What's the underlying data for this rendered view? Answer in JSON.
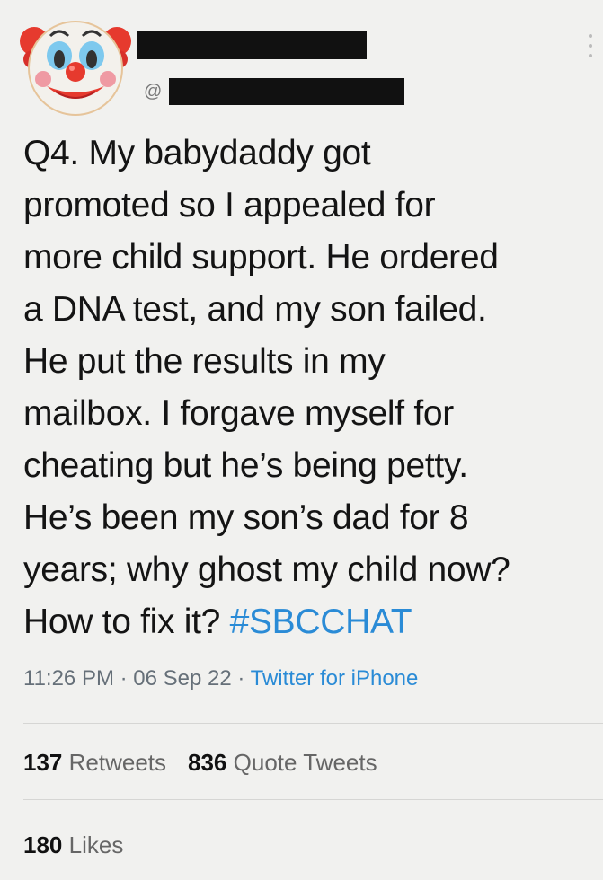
{
  "tweet": {
    "handle_prefix": "@",
    "text": "Q4. My babydaddy got\npromoted so I appealed for\nmore child support. He ordered\na DNA test, and my son failed.\nHe put the results in my\nmailbox. I forgave myself for\ncheating but he’s being petty.\nHe’s been my son’s dad for 8\nyears; why ghost my child now?\nHow to fix it? ",
    "hashtag": "#SBCCHAT",
    "time": "11:26 PM",
    "date": "06 Sep 22",
    "separator": " · ",
    "source": "Twitter for iPhone"
  },
  "stats": {
    "retweets_count": "137",
    "retweets_label": "Retweets",
    "quote_count": "836",
    "quote_label": "Quote Tweets",
    "likes_count": "180",
    "likes_label": "Likes"
  },
  "colors": {
    "link": "#2a8bd6",
    "text": "#141414",
    "meta": "#667079",
    "background": "#f1f1ef"
  },
  "icons": {
    "avatar": "clown-face-emoji",
    "more": "more-vertical-icon"
  }
}
